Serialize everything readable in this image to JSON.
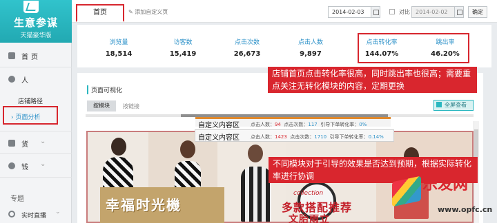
{
  "sidebar": {
    "logo_title": "生意参谋",
    "logo_subtitle": "天猫豪华版",
    "items": [
      {
        "label": "首页",
        "icon": "home-icon"
      },
      {
        "label": "人",
        "icon": "user-icon"
      }
    ],
    "sub_items": [
      "店铺路径",
      "页面分析"
    ],
    "more": [
      {
        "label": "货",
        "icon": "box-icon"
      },
      {
        "label": "钱",
        "icon": "money-icon"
      }
    ],
    "special_label": "专题",
    "live_label": "实时直播"
  },
  "header": {
    "tab_home": "首页",
    "tab_add": "添加自定义页",
    "date_start": "2014-02-03",
    "compare_label": "对比",
    "date_compare": "2014-02-02",
    "confirm_label": "确定"
  },
  "stats": [
    {
      "label": "浏览量",
      "value": "18,514"
    },
    {
      "label": "访客数",
      "value": "15,419"
    },
    {
      "label": "点击次数",
      "value": "26,673"
    },
    {
      "label": "点击人数",
      "value": "9,897"
    },
    {
      "label": "点击转化率",
      "value": "144.07%"
    },
    {
      "label": "跳出率",
      "value": "46.20%"
    }
  ],
  "section": {
    "title": "页面可视化",
    "tab_module": "按模块",
    "tab_link": "按链接",
    "fullscreen": "全屏查看"
  },
  "zones": [
    {
      "title": "自定义内容区",
      "clicks_label": "点击人数：",
      "clicks": "94",
      "times_label": "点击次数：",
      "times": "117",
      "rate_label": "引导下单转化率：",
      "rate": "0%"
    },
    {
      "title": "自定义内容区",
      "clicks_label": "点击人数：",
      "clicks": "1423",
      "times_label": "点击次数：",
      "times": "1710",
      "rate_label": "引导下单转化率：",
      "rate": "0.14%"
    }
  ],
  "canvas": {
    "brand_text": "幸福时光機",
    "collection": "collection",
    "promo_line1": "多款搭配推荐",
    "promo_line2": "文胎雨立"
  },
  "annotations": {
    "a1": "店铺首页点击转化率很高，同时跳出率也很高；需要重点关注无转化模块的内容，定期更换",
    "a2": "不同模块对于引导的效果是否达到预期，根据实际转化率进行协调"
  },
  "watermark": {
    "brand": "乐发网",
    "url": "www.opfc.cn"
  },
  "colors": {
    "accent": "#2bb7c0",
    "highlight": "#d7262e",
    "link": "#2a90c8"
  }
}
